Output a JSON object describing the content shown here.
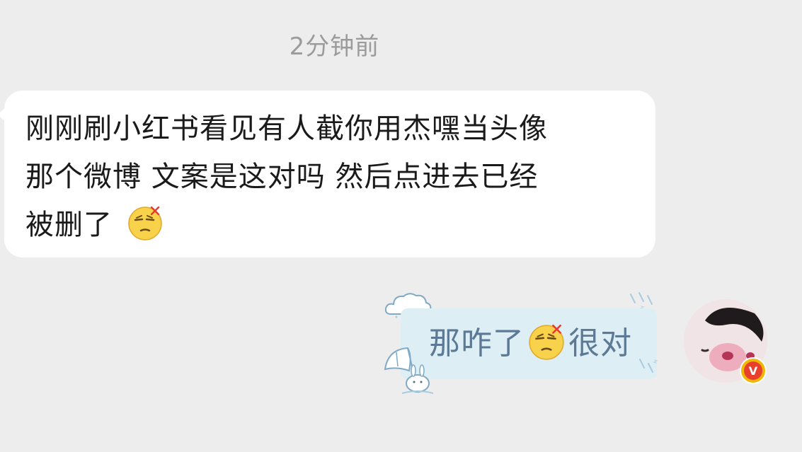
{
  "chat": {
    "timestamp": "2分钟前",
    "incoming": {
      "lines": [
        "刚刚刷小红书看见有人截你用杰嘿当头像",
        "那个微博 文案是这对吗 然后点进去已经",
        "被删了"
      ],
      "emoji": "smirk-angry-emoji"
    },
    "outgoing": {
      "text_before": "那咋了",
      "emoji": "smirk-angry-emoji",
      "text_after": "很对",
      "bubble_style": "cloud-rain-umbrella-bunny"
    },
    "self_avatar": {
      "badge": "V",
      "badge_color": "#f2b705"
    }
  },
  "colors": {
    "background": "#ededed",
    "incoming_bubble": "#ffffff",
    "outgoing_bubble": "#ddeef4",
    "outgoing_text": "#5c7a96",
    "timestamp": "#9b9b9b"
  }
}
